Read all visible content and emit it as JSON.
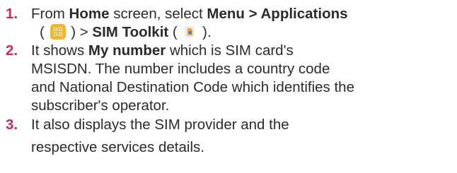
{
  "steps": [
    {
      "number": "1.",
      "lines": [
        {
          "part_from": "From ",
          "part_home": "Home",
          "part_screen": " screen, select ",
          "part_menu": "Menu > Applications"
        },
        {
          "part_open1": "( ",
          "icon1": "applications-icon",
          "part_close1": " ) > ",
          "part_sim": "SIM Toolkit",
          "part_open2": " ( ",
          "icon2": "sim-toolkit-icon",
          "part_close2": " )."
        }
      ]
    },
    {
      "number": "2.",
      "lines": [
        {
          "part_a": "It shows ",
          "part_bold": "My number",
          "part_b": " which is SIM card's"
        },
        {
          "text": "MSISDN. The number includes a country code"
        },
        {
          "text": "and National Destination Code which identifies the"
        },
        {
          "text": "subscriber's operator."
        }
      ]
    },
    {
      "number": "3.",
      "lines": [
        {
          "text": "It also displays the SIM provider and the"
        },
        {
          "text": "respective services details."
        }
      ]
    }
  ],
  "colors": {
    "number": "#d0245e",
    "text": "#2b2b2b",
    "apps_icon": "#f7b52c"
  }
}
